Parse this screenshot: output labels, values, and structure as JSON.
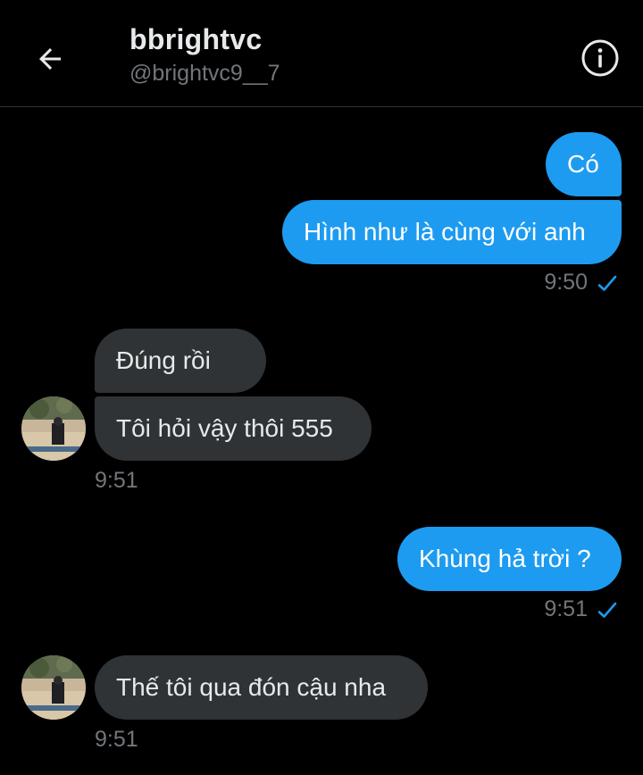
{
  "header": {
    "display_name": "bbrightvc",
    "handle": "@brightvc9__7"
  },
  "messages": [
    {
      "text": "Có",
      "direction": "outgoing"
    },
    {
      "text": "Hình như là cùng với anh",
      "direction": "outgoing"
    },
    {
      "text": "Đúng rồi",
      "direction": "incoming"
    },
    {
      "text": "Tôi hỏi vậy thôi 555",
      "direction": "incoming"
    },
    {
      "text": "Khùng hả trời ?",
      "direction": "outgoing"
    },
    {
      "text": "Thế tôi qua đón cậu nha",
      "direction": "incoming"
    }
  ],
  "timestamps": {
    "t1": "9:50",
    "t2": "9:51",
    "t3": "9:51",
    "t4": "9:51"
  },
  "icons": {
    "back": "arrow-left-icon",
    "info": "info-icon",
    "read": "checkmark-icon"
  },
  "colors": {
    "background": "#000000",
    "outgoing_bubble": "#1d9bf0",
    "incoming_bubble": "#2f3336",
    "secondary_text": "#71767b"
  }
}
